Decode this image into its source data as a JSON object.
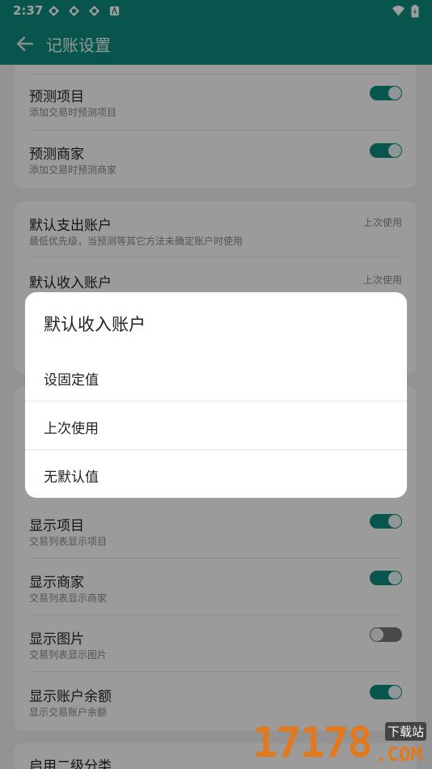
{
  "status": {
    "time": "2:37"
  },
  "appbar": {
    "title": "记账设置"
  },
  "prediction": {
    "items": [
      {
        "title": "预测项目",
        "subtitle": "添加交易时预测项目",
        "on": true
      },
      {
        "title": "预测商家",
        "subtitle": "添加交易时预测商家",
        "on": true
      }
    ]
  },
  "accounts": {
    "expense": {
      "title": "默认支出账户",
      "subtitle": "最低优先级，当预测等其它方法未确定账户时使用",
      "value": "上次使用"
    },
    "income": {
      "title": "默认收入账户",
      "value": "上次使用"
    }
  },
  "display": {
    "items": [
      {
        "title": "显示项目",
        "subtitle": "交易列表显示项目",
        "on": true
      },
      {
        "title": "显示商家",
        "subtitle": "交易列表显示商家",
        "on": true
      },
      {
        "title": "显示图片",
        "subtitle": "交易列表显示图片",
        "on": false
      },
      {
        "title": "显示账户余额",
        "subtitle": "显示交易账户余额",
        "on": true
      }
    ]
  },
  "category": {
    "title": "启用二级分类"
  },
  "dialog": {
    "title": "默认收入账户",
    "options": [
      "设固定值",
      "上次使用",
      "无默认值"
    ]
  },
  "watermark": {
    "number": "17178",
    "label": "下载站",
    "domain": ".COM"
  }
}
